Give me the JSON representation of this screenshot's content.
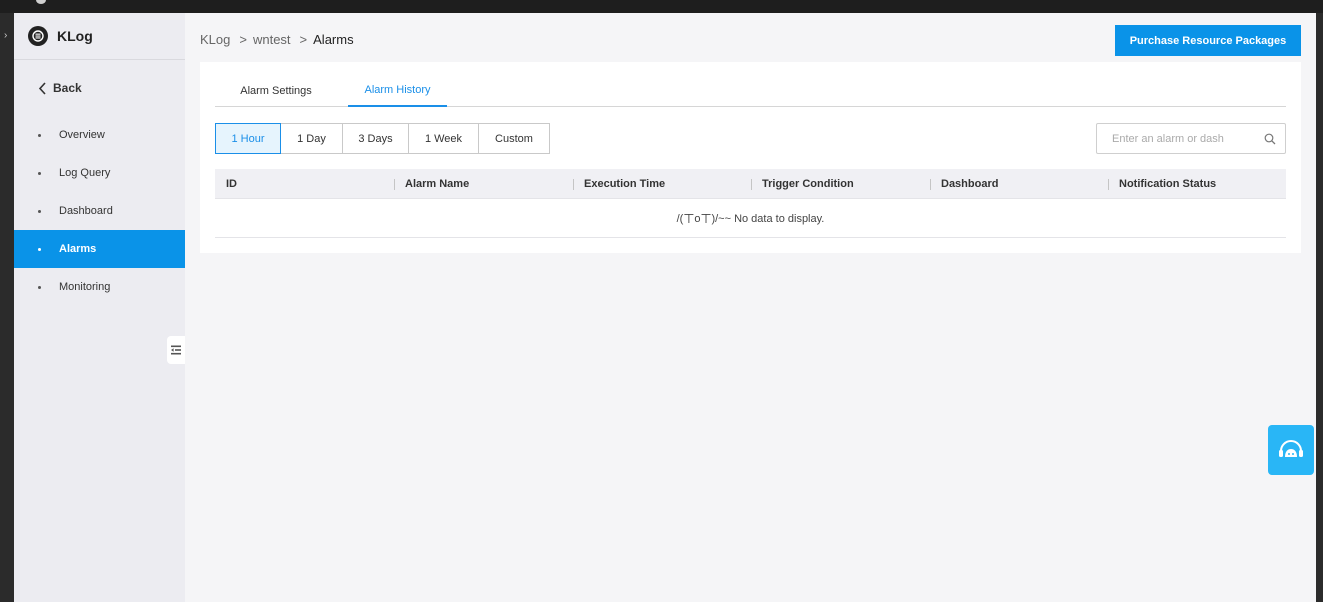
{
  "brand": {
    "name": "KLog"
  },
  "sidebar": {
    "back_label": "Back",
    "items": [
      {
        "label": "Overview",
        "active": false
      },
      {
        "label": "Log Query",
        "active": false
      },
      {
        "label": "Dashboard",
        "active": false
      },
      {
        "label": "Alarms",
        "active": true
      },
      {
        "label": "Monitoring",
        "active": false
      }
    ]
  },
  "breadcrumb": {
    "items": [
      "KLog",
      "wntest",
      "Alarms"
    ],
    "separator": ">"
  },
  "header": {
    "purchase_label": "Purchase Resource Packages"
  },
  "tabs": [
    {
      "label": "Alarm Settings",
      "active": false
    },
    {
      "label": "Alarm History",
      "active": true
    }
  ],
  "time_ranges": [
    {
      "label": "1 Hour",
      "active": true
    },
    {
      "label": "1 Day",
      "active": false
    },
    {
      "label": "3 Days",
      "active": false
    },
    {
      "label": "1 Week",
      "active": false
    },
    {
      "label": "Custom",
      "active": false
    }
  ],
  "search": {
    "placeholder": "Enter an alarm or dash",
    "value": ""
  },
  "table": {
    "columns": [
      "ID",
      "Alarm Name",
      "Execution Time",
      "Trigger Condition",
      "Dashboard",
      "Notification Status"
    ],
    "rows": [],
    "empty_text": "/(ㄒoㄒ)/~~ No data to display."
  },
  "colors": {
    "accent": "#0a93e8",
    "sidebar_bg": "#ececf1",
    "main_bg": "#f5f5f7",
    "float_button": "#29b6f6"
  },
  "icons": {
    "brand": "klog-logo-icon",
    "back": "chevron-left-icon",
    "collapse": "collapse-sidebar-icon",
    "search": "search-icon",
    "float": "customer-service-icon"
  }
}
